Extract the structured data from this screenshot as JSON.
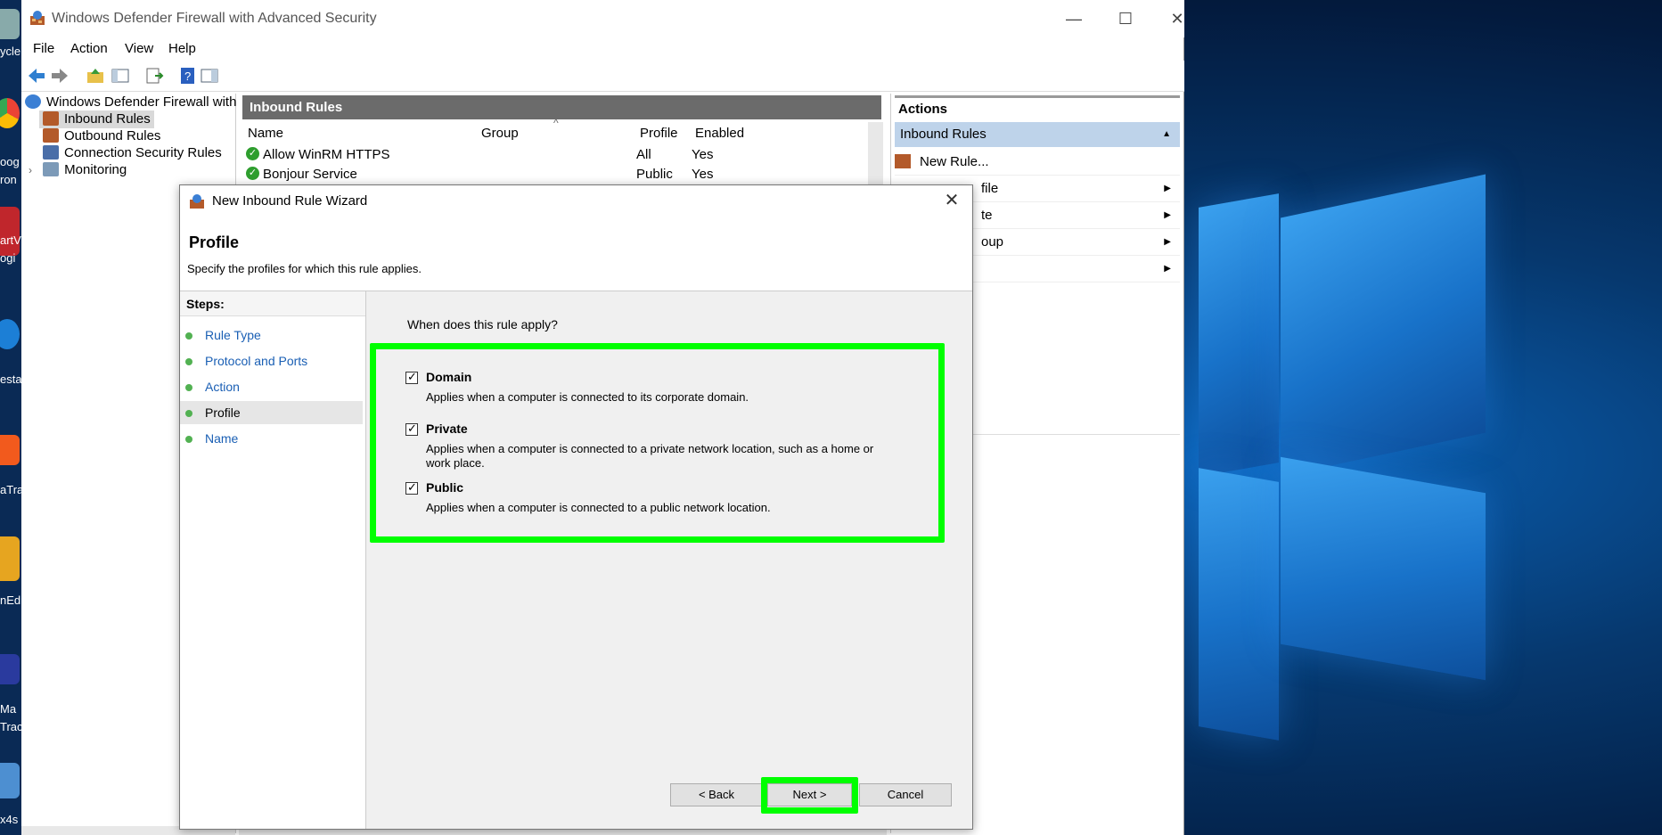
{
  "window": {
    "title": "Windows Defender Firewall with Advanced Security",
    "minimize": "—",
    "maximize": "☐",
    "close": "✕"
  },
  "menu": [
    "File",
    "Action",
    "View",
    "Help"
  ],
  "tree": {
    "root": "Windows Defender Firewall with",
    "items": [
      "Inbound Rules",
      "Outbound Rules",
      "Connection Security Rules",
      "Monitoring"
    ]
  },
  "center": {
    "header": "Inbound Rules",
    "columns": [
      "Name",
      "Group",
      "Profile",
      "Enabled"
    ],
    "rows": [
      {
        "name": "Allow WinRM HTTPS",
        "group": "",
        "profile": "All",
        "enabled": "Yes"
      },
      {
        "name": "Bonjour Service",
        "group": "",
        "profile": "Public",
        "enabled": "Yes"
      }
    ]
  },
  "actions": {
    "header": "Actions",
    "section": "Inbound Rules",
    "items": [
      "New Rule...",
      "file",
      "te",
      "oup",
      ""
    ]
  },
  "desktop": {
    "labels": [
      "ycle",
      "oog",
      "ron",
      "artV",
      "ogi",
      "esta",
      "aTra",
      "nEdi",
      "Ma",
      "Trac",
      "x4s"
    ]
  },
  "wizard": {
    "title": "New Inbound Rule Wizard",
    "heading": "Profile",
    "subheading": "Specify the profiles for which this rule applies.",
    "steps_title": "Steps:",
    "steps": [
      {
        "label": "Rule Type",
        "active": false
      },
      {
        "label": "Protocol and Ports",
        "active": false
      },
      {
        "label": "Action",
        "active": false
      },
      {
        "label": "Profile",
        "active": true
      },
      {
        "label": "Name",
        "active": false
      }
    ],
    "question": "When does this rule apply?",
    "options": [
      {
        "name": "Domain",
        "checked": true,
        "desc": "Applies when a computer is connected to its corporate domain."
      },
      {
        "name": "Private",
        "checked": true,
        "desc": "Applies when a computer is connected to a private network location, such as a home or work place."
      },
      {
        "name": "Public",
        "checked": true,
        "desc": "Applies when a computer is connected to a public network location."
      }
    ],
    "buttons": {
      "back": "< Back",
      "next": "Next >",
      "cancel": "Cancel"
    }
  },
  "colors": {
    "highlight": "#00ff00",
    "step_link": "#1a5fb4",
    "actions_selected": "#bed3ea",
    "pane_header": "#6b6b6b"
  }
}
